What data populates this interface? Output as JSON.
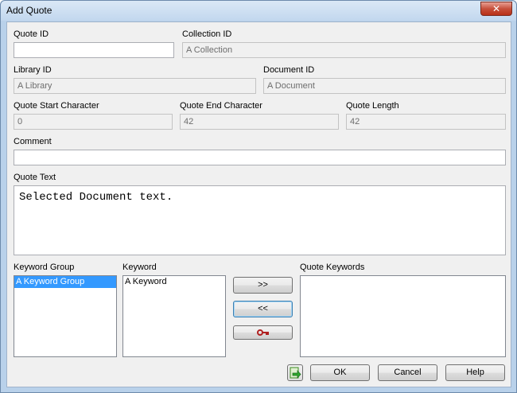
{
  "window": {
    "title": "Add Quote",
    "close_label": "✕"
  },
  "fields": {
    "quote_id": {
      "label": "Quote ID",
      "value": ""
    },
    "collection_id": {
      "label": "Collection ID",
      "value": "A Collection"
    },
    "library_id": {
      "label": "Library ID",
      "value": "A Library"
    },
    "document_id": {
      "label": "Document ID",
      "value": "A Document"
    },
    "start_char": {
      "label": "Quote Start Character",
      "value": "0"
    },
    "end_char": {
      "label": "Quote End Character",
      "value": "42"
    },
    "length": {
      "label": "Quote Length",
      "value": "42"
    },
    "comment": {
      "label": "Comment",
      "value": ""
    },
    "quote_text": {
      "label": "Quote Text",
      "value": "Selected Document text."
    }
  },
  "keywords": {
    "group_label": "Keyword Group",
    "keyword_label": "Keyword",
    "quote_keywords_label": "Quote Keywords",
    "groups": [
      "A Keyword Group"
    ],
    "items": [
      "A Keyword"
    ],
    "add_label": ">>",
    "remove_label": "<<"
  },
  "buttons": {
    "ok": "OK",
    "cancel": "Cancel",
    "help": "Help"
  },
  "icons": {
    "key": "key-icon",
    "export": "export-arrow-icon"
  },
  "colors": {
    "selection": "#3399ff",
    "titlebar": "#c2d7ee",
    "close": "#c7503b"
  }
}
